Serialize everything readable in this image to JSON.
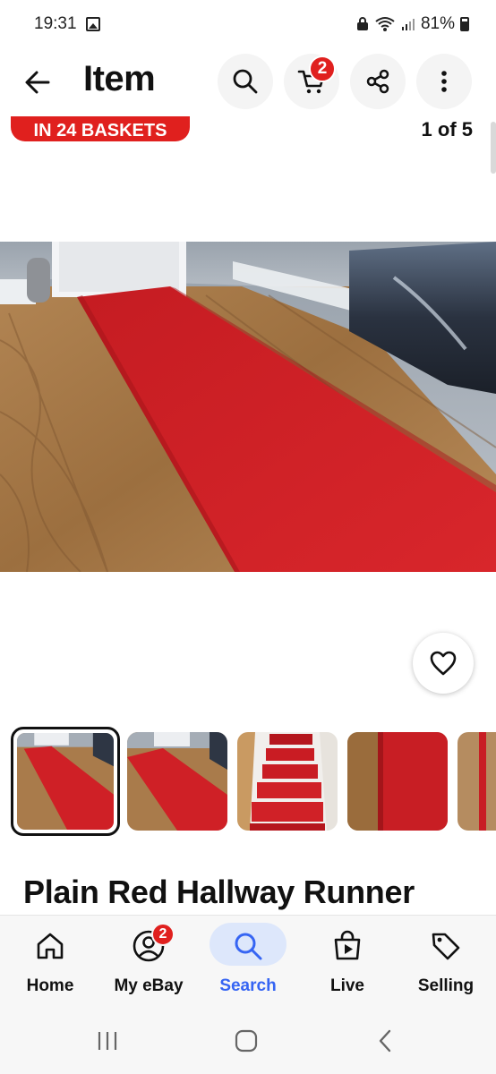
{
  "status_bar": {
    "time": "19:31",
    "battery": "81%"
  },
  "header": {
    "title": "Item",
    "cart_count": "2"
  },
  "gallery": {
    "badge_text": "IN 24 BASKETS",
    "counter": "1 of 5",
    "thumbnail_count": 5,
    "selected_index": 0
  },
  "product": {
    "title": "Plain Red Hallway Runner"
  },
  "bottom_nav": {
    "items": [
      {
        "label": "Home",
        "icon": "home-icon"
      },
      {
        "label": "My eBay",
        "icon": "user-icon",
        "badge": "2"
      },
      {
        "label": "Search",
        "icon": "search-icon",
        "active": true
      },
      {
        "label": "Live",
        "icon": "live-bag-icon"
      },
      {
        "label": "Selling",
        "icon": "tag-icon"
      }
    ]
  },
  "colors": {
    "accent": "#3665f3",
    "badge_red": "#e0201e",
    "carpet_red": "#d01f24"
  }
}
